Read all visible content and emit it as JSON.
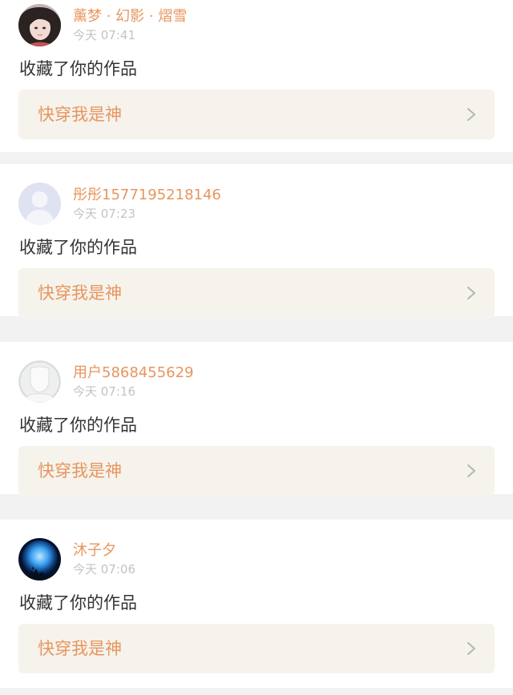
{
  "notifications": [
    {
      "username": "薰梦 · 幻影 · 熠雪",
      "time": "今天 07:41",
      "action": "收藏了你的作品",
      "work_title": "快穿我是神",
      "avatar_icon": "user-photo-avatar"
    },
    {
      "username": "彤彤1577195218146",
      "time": "今天 07:23",
      "action": "收藏了你的作品",
      "work_title": "快穿我是神",
      "avatar_icon": "default-user-avatar"
    },
    {
      "username": "用户5868455629",
      "time": "今天 07:16",
      "action": "收藏了你的作品",
      "work_title": "快穿我是神",
      "avatar_icon": "blank-user-avatar"
    },
    {
      "username": "沐子夕",
      "time": "今天 07:06",
      "action": "收藏了你的作品",
      "work_title": "快穿我是神",
      "avatar_icon": "moon-night-avatar"
    }
  ],
  "colors": {
    "accent": "#e8955d",
    "secondary_text": "#c3c3c3",
    "card_link_bg": "#f5f3ec",
    "separator": "#f2f2f2"
  }
}
